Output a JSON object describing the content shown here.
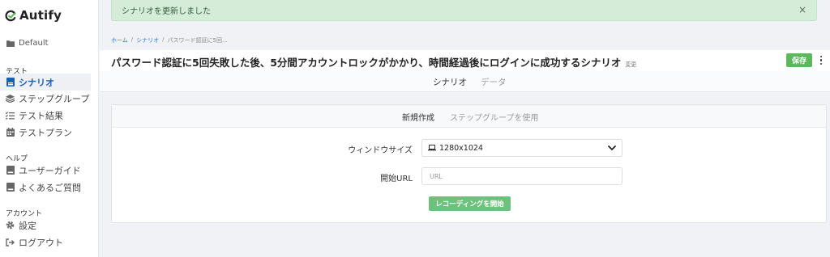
{
  "app": {
    "brand": "Autify"
  },
  "sidebar": {
    "project": "Default",
    "sections": [
      {
        "heading": "テスト"
      },
      {
        "heading": "ヘルプ"
      },
      {
        "heading": "アカウント"
      }
    ],
    "test_items": [
      {
        "label": "シナリオ",
        "icon": "scenario-icon",
        "active": true
      },
      {
        "label": "ステップグループ",
        "icon": "layers-icon"
      },
      {
        "label": "テスト結果",
        "icon": "checklist-icon"
      },
      {
        "label": "テストプラン",
        "icon": "calendar-icon"
      }
    ],
    "help_items": [
      {
        "label": "ユーザーガイド",
        "icon": "book-icon"
      },
      {
        "label": "よくあるご質問",
        "icon": "book-icon"
      }
    ],
    "account_items": [
      {
        "label": "設定",
        "icon": "gear-icon"
      },
      {
        "label": "ログアウト",
        "icon": "logout-icon"
      }
    ]
  },
  "alert": {
    "message": "シナリオを更新しました",
    "close": "×"
  },
  "breadcrumb": {
    "home": "ホーム",
    "sep1": "/",
    "scenario": "シナリオ",
    "sep2": "/",
    "current": "パスワード認証に5回..."
  },
  "header": {
    "title": "パスワード認証に5回失敗した後、5分間アカウントロックがかかり、時間経過後にログインに成功するシナリオ",
    "change_link": "変更",
    "save_label": "保存"
  },
  "tabs": {
    "scenario": "シナリオ",
    "data": "データ"
  },
  "card": {
    "tabs": {
      "new": "新規作成",
      "use_step_group": "ステップグループを使用"
    },
    "window_size_label": "ウィンドウサイズ",
    "window_size_value": "1280x1024",
    "start_url_label": "開始URL",
    "start_url_placeholder": "URL",
    "record_button": "レコーディングを開始"
  },
  "colors": {
    "accent_green": "#5cb85c",
    "link_blue": "#2a7bd6",
    "alert_bg": "#d4ecd8"
  }
}
